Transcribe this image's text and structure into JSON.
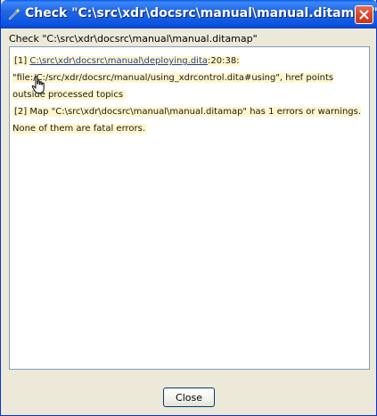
{
  "window": {
    "title": "Check \"C:\\src\\xdr\\docsrc\\manual\\manual.ditamap\""
  },
  "caption": "Check \"C:\\src\\xdr\\docsrc\\manual\\manual.ditamap\"",
  "messages": [
    {
      "prefix": "[1] ",
      "link": "C:\\src\\xdr\\docsrc\\manual\\deploying.dita",
      "suffix": ":20:38: \"file:/C:/src/xdr/docsrc/manual/using_xdrcontrol.dita#using\", href points outside processed topics"
    },
    {
      "text": "[2] Map \"C:\\src\\xdr\\docsrc\\manual\\manual.ditamap\" has 1 errors or warnings. None of them are fatal errors."
    }
  ],
  "buttons": {
    "close_label": "Close"
  },
  "colors": {
    "titlebar": "#0B55E4",
    "message_highlight": "#FFF6CC",
    "link": "#1F3FA0",
    "dialog_background": "#ECE9D8"
  },
  "icons": {
    "app": "wand-icon",
    "window_close": "close-icon",
    "pointer": "hand-cursor-icon"
  }
}
